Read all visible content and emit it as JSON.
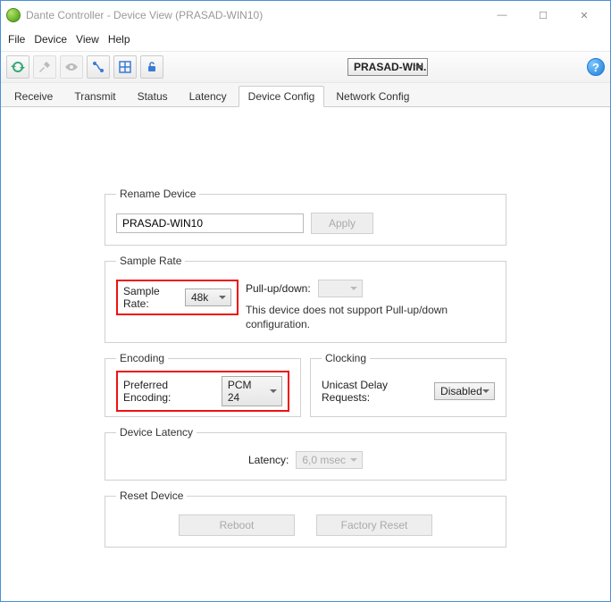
{
  "window": {
    "title": "Dante Controller - Device View (PRASAD-WIN10)"
  },
  "menu": {
    "file": "File",
    "device": "Device",
    "view": "View",
    "help": "Help"
  },
  "toolbar": {
    "device_selected": "PRASAD-WIN...",
    "help_label": "?"
  },
  "tabs": {
    "receive": "Receive",
    "transmit": "Transmit",
    "status": "Status",
    "latency": "Latency",
    "device_config": "Device Config",
    "network_config": "Network Config"
  },
  "rename": {
    "legend": "Rename Device",
    "value": "PRASAD-WIN10",
    "apply": "Apply"
  },
  "sample_rate": {
    "legend": "Sample Rate",
    "label": "Sample Rate:",
    "value": "48k",
    "pullup_label": "Pull-up/down:",
    "note": "This device does not support Pull-up/down configuration."
  },
  "encoding": {
    "legend": "Encoding",
    "label": "Preferred Encoding:",
    "value": "PCM 24"
  },
  "clocking": {
    "legend": "Clocking",
    "label": "Unicast Delay Requests:",
    "value": "Disabled"
  },
  "latency": {
    "legend": "Device Latency",
    "label": "Latency:",
    "value": "6,0 msec"
  },
  "reset": {
    "legend": "Reset Device",
    "reboot": "Reboot",
    "factory": "Factory Reset"
  }
}
